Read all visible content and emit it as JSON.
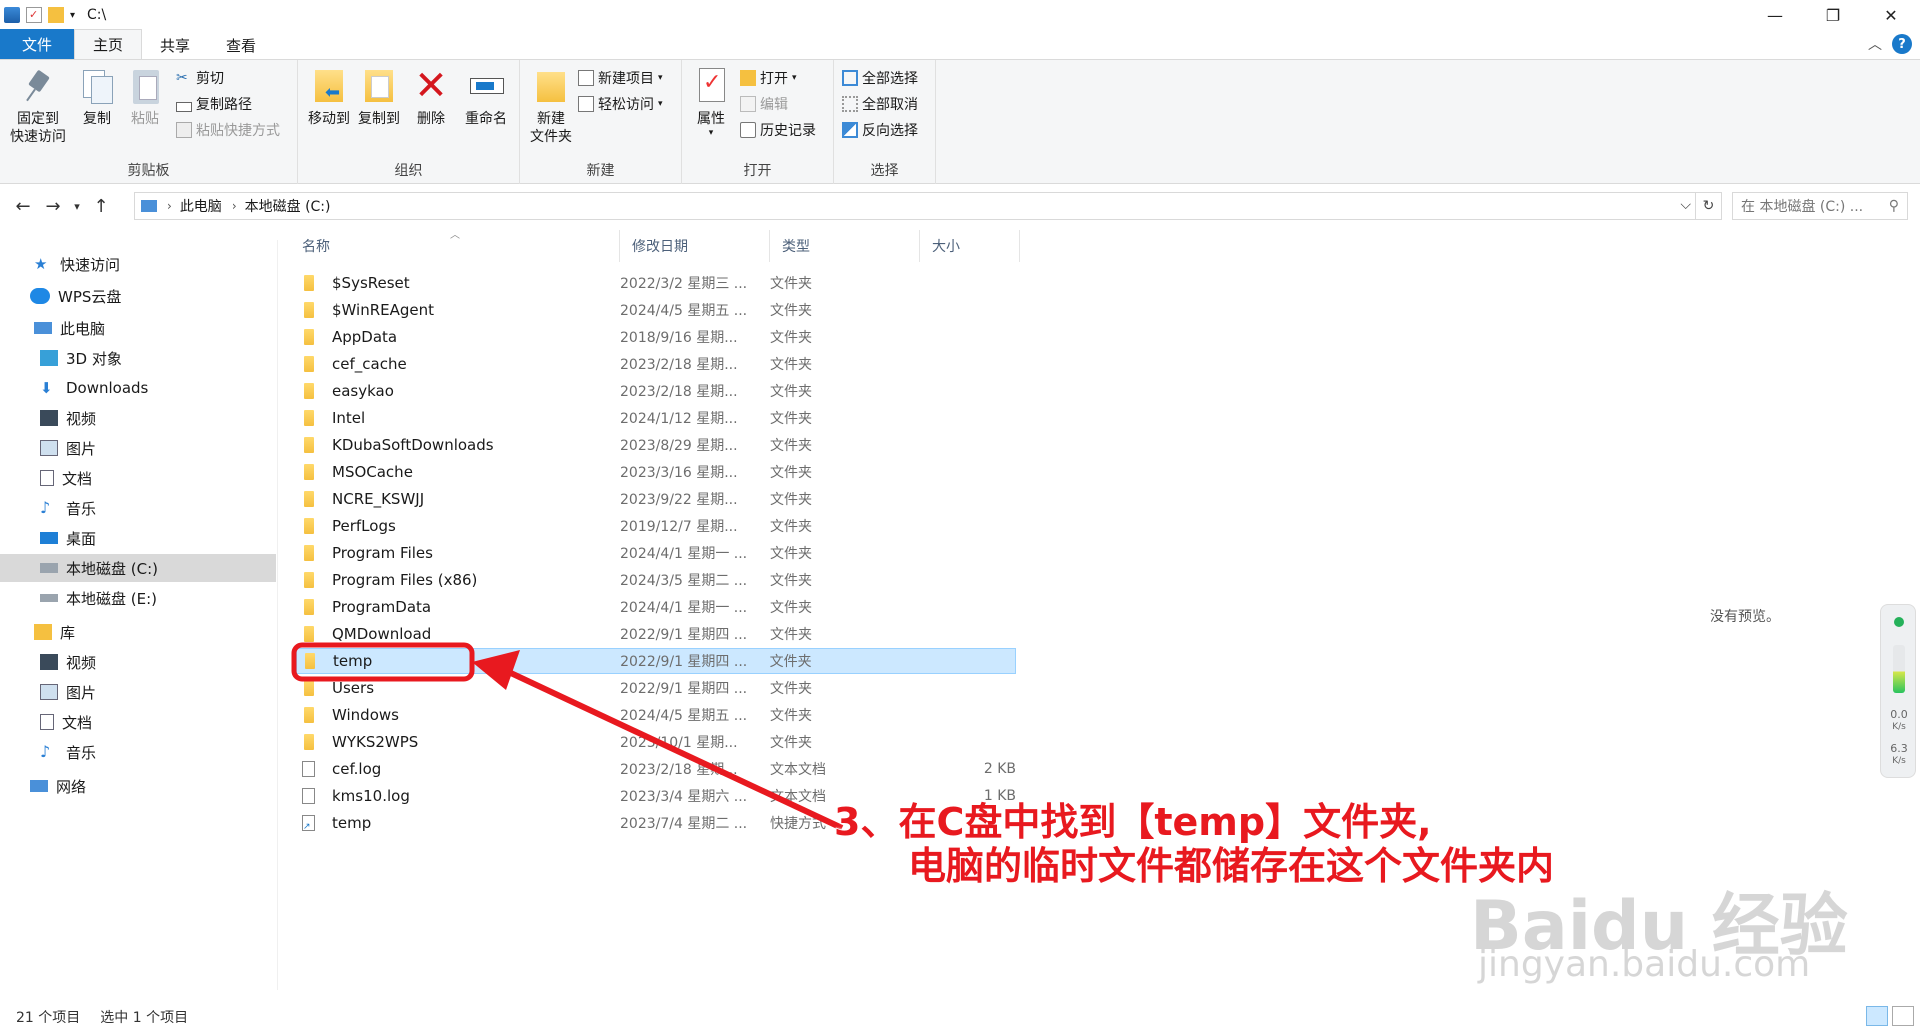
{
  "window": {
    "title": "C:\\",
    "controls": {
      "minimize": "—",
      "maximize": "❐",
      "close": "✕"
    }
  },
  "tabs": [
    {
      "label": "文件"
    },
    {
      "label": "主页"
    },
    {
      "label": "共享"
    },
    {
      "label": "查看"
    }
  ],
  "ribbon": {
    "clipboard": {
      "group_label": "剪贴板",
      "pin_line1": "固定到",
      "pin_line2": "快速访问",
      "copy": "复制",
      "paste": "粘贴",
      "cut": "剪切",
      "copy_path": "复制路径",
      "paste_shortcut": "粘贴快捷方式"
    },
    "organize": {
      "group_label": "组织",
      "move_to": "移动到",
      "copy_to": "复制到",
      "delete": "删除",
      "rename": "重命名"
    },
    "new": {
      "group_label": "新建",
      "new_folder_line1": "新建",
      "new_folder_line2": "文件夹",
      "new_item": "新建项目",
      "easy_access": "轻松访问"
    },
    "open": {
      "group_label": "打开",
      "properties": "属性",
      "open": "打开",
      "edit": "编辑",
      "history": "历史记录"
    },
    "select": {
      "group_label": "选择",
      "select_all": "全部选择",
      "select_none": "全部取消",
      "invert": "反向选择"
    }
  },
  "address": {
    "segments": [
      "此电脑",
      "本地磁盘 (C:)"
    ],
    "search_placeholder": "在 本地磁盘 (C:) ..."
  },
  "nav_pane": [
    {
      "label": "快速访问",
      "icon": "star-icon"
    },
    {
      "label": "WPS云盘",
      "icon": "cloud-icon"
    },
    {
      "label": "此电脑",
      "icon": "computer-icon"
    },
    {
      "label": "3D 对象",
      "icon": "cube-icon"
    },
    {
      "label": "Downloads",
      "icon": "download-icon"
    },
    {
      "label": "视频",
      "icon": "video-icon"
    },
    {
      "label": "图片",
      "icon": "picture-icon"
    },
    {
      "label": "文档",
      "icon": "document-icon"
    },
    {
      "label": "音乐",
      "icon": "music-icon"
    },
    {
      "label": "桌面",
      "icon": "desktop-icon"
    },
    {
      "label": "本地磁盘 (C:)",
      "icon": "drive-icon"
    },
    {
      "label": "本地磁盘 (E:)",
      "icon": "drive-icon"
    },
    {
      "label": "库",
      "icon": "library-icon"
    },
    {
      "label": "视频",
      "icon": "video-icon"
    },
    {
      "label": "图片",
      "icon": "picture-icon"
    },
    {
      "label": "文档",
      "icon": "document-icon"
    },
    {
      "label": "音乐",
      "icon": "music-icon"
    },
    {
      "label": "网络",
      "icon": "network-icon"
    }
  ],
  "columns": {
    "name": "名称",
    "date": "修改日期",
    "type": "类型",
    "size": "大小"
  },
  "files": [
    {
      "name": "$SysReset",
      "date": "2022/3/2 星期三 ...",
      "type": "文件夹",
      "size": "",
      "kind": "folder"
    },
    {
      "name": "$WinREAgent",
      "date": "2024/4/5 星期五 ...",
      "type": "文件夹",
      "size": "",
      "kind": "folder"
    },
    {
      "name": "AppData",
      "date": "2018/9/16 星期...",
      "type": "文件夹",
      "size": "",
      "kind": "folder"
    },
    {
      "name": "cef_cache",
      "date": "2023/2/18 星期...",
      "type": "文件夹",
      "size": "",
      "kind": "folder"
    },
    {
      "name": "easykao",
      "date": "2023/2/18 星期...",
      "type": "文件夹",
      "size": "",
      "kind": "folder"
    },
    {
      "name": "Intel",
      "date": "2024/1/12 星期...",
      "type": "文件夹",
      "size": "",
      "kind": "folder"
    },
    {
      "name": "KDubaSoftDownloads",
      "date": "2023/8/29 星期...",
      "type": "文件夹",
      "size": "",
      "kind": "folder"
    },
    {
      "name": "MSOCache",
      "date": "2023/3/16 星期...",
      "type": "文件夹",
      "size": "",
      "kind": "folder"
    },
    {
      "name": "NCRE_KSWJJ",
      "date": "2023/9/22 星期...",
      "type": "文件夹",
      "size": "",
      "kind": "folder"
    },
    {
      "name": "PerfLogs",
      "date": "2019/12/7 星期...",
      "type": "文件夹",
      "size": "",
      "kind": "folder"
    },
    {
      "name": "Program Files",
      "date": "2024/4/1 星期一 ...",
      "type": "文件夹",
      "size": "",
      "kind": "folder"
    },
    {
      "name": "Program Files (x86)",
      "date": "2024/3/5 星期二 ...",
      "type": "文件夹",
      "size": "",
      "kind": "folder"
    },
    {
      "name": "ProgramData",
      "date": "2024/4/1 星期一 ...",
      "type": "文件夹",
      "size": "",
      "kind": "folder"
    },
    {
      "name": "QMDownload",
      "date": "2022/9/1 星期四 ...",
      "type": "文件夹",
      "size": "",
      "kind": "folder"
    },
    {
      "name": "temp",
      "date": "2022/9/1 星期四 ...",
      "type": "文件夹",
      "size": "",
      "kind": "folder",
      "selected": true
    },
    {
      "name": "Users",
      "date": "2022/9/1 星期四 ...",
      "type": "文件夹",
      "size": "",
      "kind": "folder"
    },
    {
      "name": "Windows",
      "date": "2024/4/5 星期五 ...",
      "type": "文件夹",
      "size": "",
      "kind": "folder"
    },
    {
      "name": "WYKS2WPS",
      "date": "2023/10/1 星期...",
      "type": "文件夹",
      "size": "",
      "kind": "folder"
    },
    {
      "name": "cef.log",
      "date": "2023/2/18 星期...",
      "type": "文本文档",
      "size": "2 KB",
      "kind": "text"
    },
    {
      "name": "kms10.log",
      "date": "2023/3/4 星期六 ...",
      "type": "文本文档",
      "size": "1 KB",
      "kind": "text"
    },
    {
      "name": "temp",
      "date": "2023/7/4 星期二 ...",
      "type": "快捷方式",
      "size": "",
      "kind": "shortcut"
    }
  ],
  "preview": {
    "text": "没有预览。"
  },
  "speed_widget": {
    "up": "0.0",
    "up_unit": "K/s",
    "down": "6.3",
    "down_unit": "K/s"
  },
  "status": {
    "count": "21 个项目",
    "selected": "选中 1 个项目"
  },
  "annotation": {
    "line1": "3、在C盘中找到【temp】文件夹,",
    "line2": "电脑的临时文件都储存在这个文件夹内",
    "color": "#e8191f"
  },
  "watermark": {
    "line1": "Baidu 经验",
    "line2": "jingyan.baidu.com"
  }
}
